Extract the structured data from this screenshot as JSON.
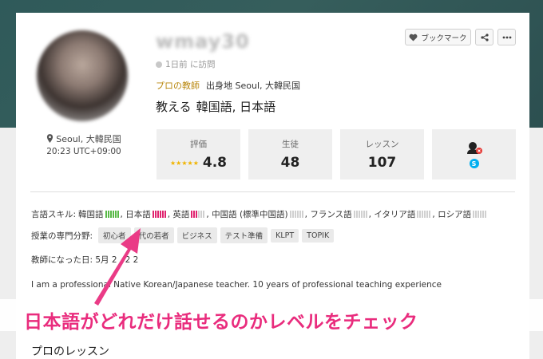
{
  "profile": {
    "username": "wmay30",
    "last_visit": "1日前 に訪問",
    "pro_label": "プロの教師",
    "hometown": "出身地 Seoul, 大韓民国",
    "teaches_label": "教える",
    "teaches_value": "韓国語, 日本語",
    "location": "Seoul, 大韓民国",
    "local_time": "20:23 UTC+09:00"
  },
  "actions": {
    "bookmark_label": "ブックマーク"
  },
  "stats": {
    "rating_label": "評価",
    "rating_value": "4.8",
    "stars": "★★★★★",
    "students_label": "生徒",
    "students_value": "48",
    "lessons_label": "レッスン",
    "lessons_value": "107"
  },
  "languages": {
    "label": "言語スキル:",
    "items": [
      {
        "name": "韓国語",
        "level": 6,
        "color": "#58b947"
      },
      {
        "name": "日本語",
        "level": 6,
        "color": "#e0246f"
      },
      {
        "name": "英語",
        "level": 3,
        "color": "#e0246f"
      },
      {
        "name": "中国語 (標準中国語)",
        "level": 0,
        "color": "#d0d0d0"
      },
      {
        "name": "フランス語",
        "level": 0,
        "color": "#d0d0d0"
      },
      {
        "name": "イタリア語",
        "level": 0,
        "color": "#d0d0d0"
      },
      {
        "name": "ロシア語",
        "level": 0,
        "color": "#d0d0d0"
      }
    ],
    "separator": ","
  },
  "subjects": {
    "label": "授業の専門分野:",
    "tags": [
      "初心者",
      "代の若者",
      "ビジネス",
      "テスト準備",
      "KLPT",
      "TOPIK"
    ]
  },
  "since": "教師になった日: 5月 2 , 2 2",
  "intro": "I am a professional Native Korean/Japanese teacher. 10 years of professional teaching experience",
  "callout": "日本語がどれだけ話せるのかレベルをチェック",
  "section_title": "プロのレッスン",
  "colors": {
    "banner": "#2f5a5a",
    "pro": "#b8860b",
    "star": "#f0b400",
    "callout": "#e92c7d",
    "green_level": "#58b947",
    "pink_level": "#e0246f"
  }
}
